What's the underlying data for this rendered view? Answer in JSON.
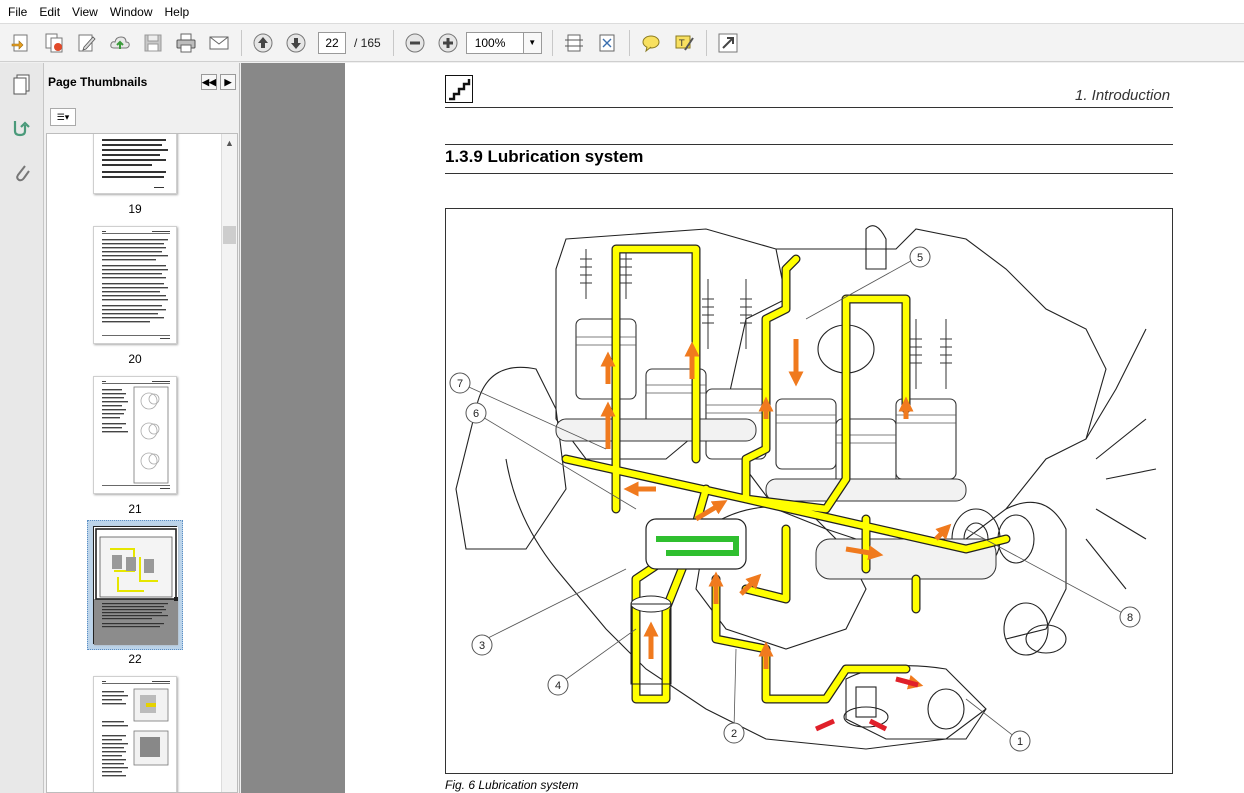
{
  "menu": [
    "File",
    "Edit",
    "View",
    "Window",
    "Help"
  ],
  "toolbar": {
    "current_page": "22",
    "page_total": "/ 165",
    "zoom": "100%"
  },
  "sidebar": {
    "title": "Page Thumbnails",
    "thumbnails": [
      {
        "label": "19"
      },
      {
        "label": "20"
      },
      {
        "label": "21"
      },
      {
        "label": "22"
      },
      {
        "label": ""
      }
    ]
  },
  "document": {
    "chapter_header": "1. Introduction",
    "section_title": "1.3.9  Lubrication system",
    "figure_caption": "Fig. 6  Lubrication system",
    "callouts": [
      "1",
      "2",
      "3",
      "4",
      "5",
      "6",
      "7",
      "8"
    ]
  },
  "colors": {
    "oil_line": "#ffff00",
    "flow_arrow": "#f07a1e",
    "intake_arrow": "#e0202a",
    "cooler_arrow": "#2fbf2f"
  }
}
